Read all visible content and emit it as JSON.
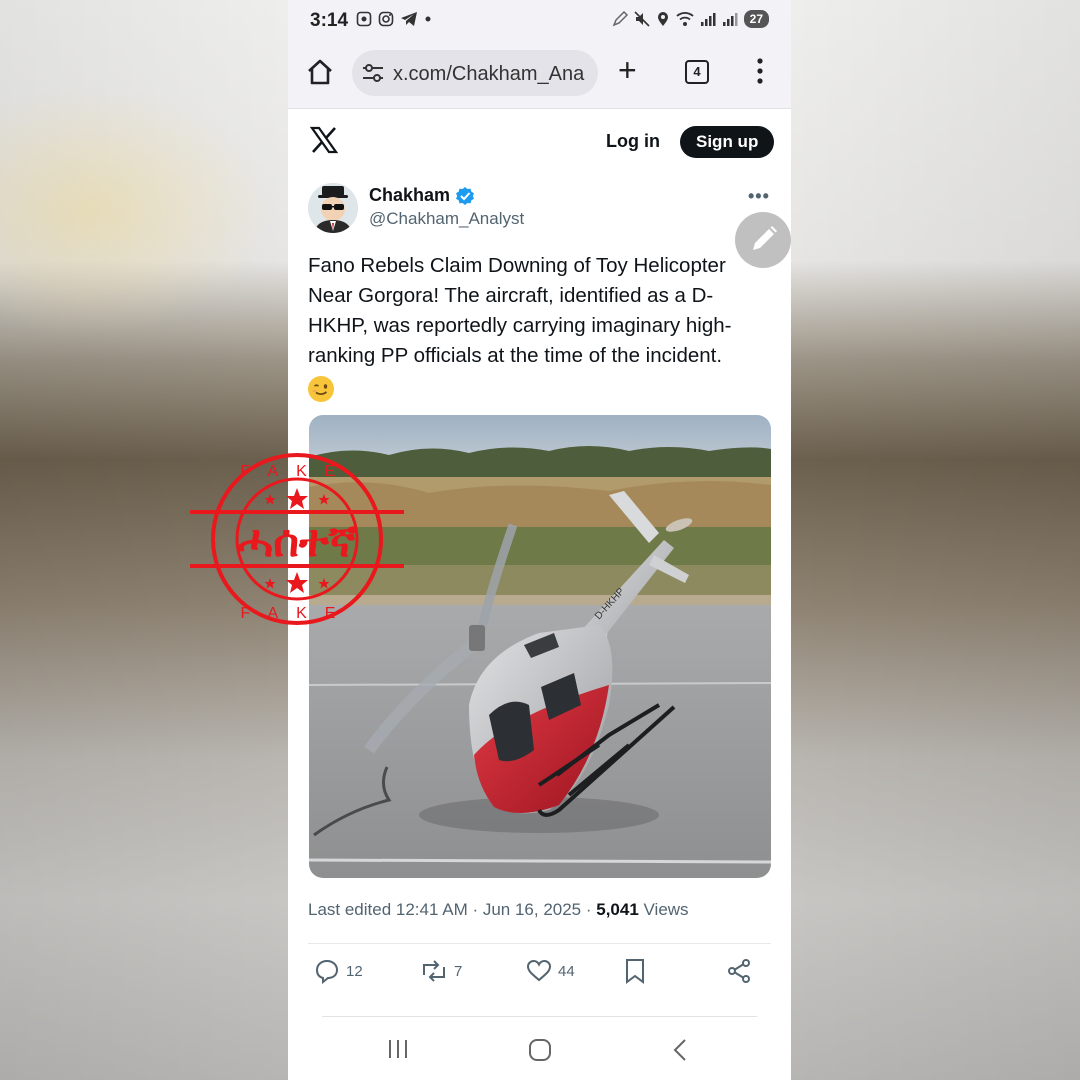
{
  "status_bar": {
    "time": "3:14",
    "battery": "27"
  },
  "browser": {
    "url": "x.com/Chakham_Ana",
    "tab_count": "4"
  },
  "x_header": {
    "login_label": "Log in",
    "signup_label": "Sign up"
  },
  "tweet": {
    "author_name": "Chakham",
    "author_handle": "@Chakham_Analyst",
    "text": "Fano Rebels Claim Downing of Toy Helicopter Near Gorgora! The aircraft, identified as a D-HKHP, was reportedly carrying imaginary high-ranking PP officials at the time of the incident.",
    "meta_prefix": "Last edited 12:41 AM · Jun 16, 2025 · ",
    "views_count": "5,041",
    "views_label": " Views",
    "image_registration": "D-HKHP",
    "actions": {
      "replies": "12",
      "reposts": "7",
      "likes": "44"
    }
  },
  "stamp": {
    "top_text": "FAKE",
    "bottom_text": "FAKE",
    "main_text": "ሓሰተኛ",
    "color": "#e8181c"
  },
  "colors": {
    "x_black": "#0f1419",
    "verified_blue": "#1d9bf0",
    "secondary_text": "#536471"
  }
}
